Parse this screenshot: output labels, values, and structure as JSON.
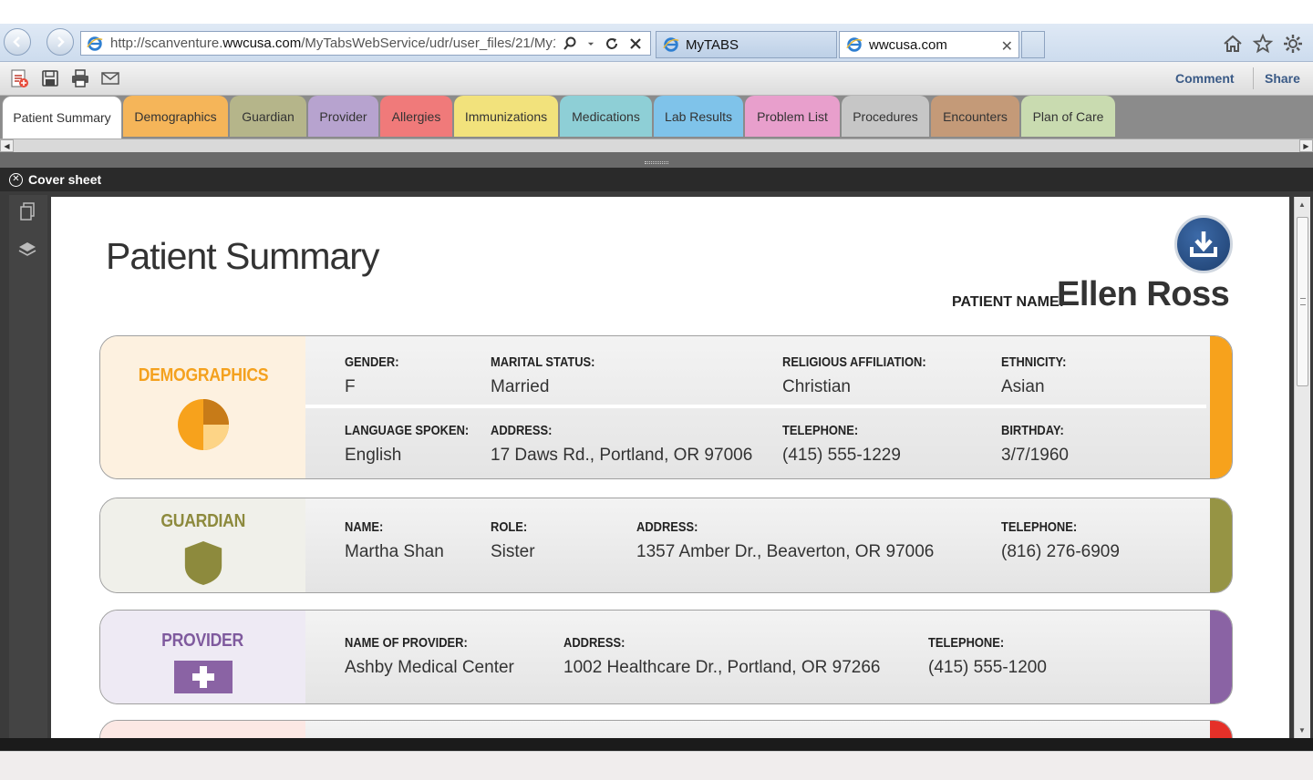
{
  "browser": {
    "url_prefix": "http://scanventure.",
    "url_domain": "wwcusa.com",
    "url_suffix": "/MyTabsWebService/udr/user_files/21/My1",
    "tabs": [
      {
        "title": "MyTABS"
      },
      {
        "title": "wwcusa.com",
        "close": "✕"
      }
    ]
  },
  "toolbar": {
    "comment_label": "Comment",
    "share_label": "Share"
  },
  "tabs": [
    {
      "label": "Patient Summary",
      "color": "#ffffff"
    },
    {
      "label": "Demographics",
      "color": "#f5b559"
    },
    {
      "label": "Guardian",
      "color": "#b5b58a"
    },
    {
      "label": "Provider",
      "color": "#b7a3cf"
    },
    {
      "label": "Allergies",
      "color": "#f07a7a"
    },
    {
      "label": "Immunizations",
      "color": "#f2e27c"
    },
    {
      "label": "Medications",
      "color": "#8ecfd6"
    },
    {
      "label": "Lab Results",
      "color": "#7fc3ea"
    },
    {
      "label": "Problem List",
      "color": "#e89fcc"
    },
    {
      "label": "Procedures",
      "color": "#c6c6c6"
    },
    {
      "label": "Encounters",
      "color": "#c49a78"
    },
    {
      "label": "Plan of Care",
      "color": "#c9dbb0"
    }
  ],
  "viewer": {
    "title": "Cover sheet",
    "close_glyph": "✕"
  },
  "doc": {
    "title": "Patient Summary",
    "patient_name_label": "PATIENT NAME:",
    "patient_name": "Ellen Ross"
  },
  "demographics": {
    "title": "DEMOGRAPHICS",
    "gender_label": "GENDER:",
    "gender": "F",
    "marital_label": "MARITAL STATUS:",
    "marital": "Married",
    "religion_label": "RELIGIOUS AFFILIATION:",
    "religion": "Christian",
    "ethnicity_label": "ETHNICITY:",
    "ethnicity": "Asian",
    "language_label": "LANGUAGE SPOKEN:",
    "language": "English",
    "address_label": "ADDRESS:",
    "address": "17 Daws Rd., Portland, OR 97006",
    "telephone_label": "TELEPHONE:",
    "telephone": "(415) 555-1229",
    "birthday_label": "BIRTHDAY:",
    "birthday": "3/7/1960"
  },
  "guardian": {
    "title": "GUARDIAN",
    "name_label": "NAME:",
    "name": "Martha Shan",
    "role_label": "ROLE:",
    "role": "Sister",
    "address_label": "ADDRESS:",
    "address": "1357 Amber Dr., Beaverton, OR 97006",
    "telephone_label": "TELEPHONE:",
    "telephone": "(816) 276-6909"
  },
  "provider": {
    "title": "PROVIDER",
    "name_label": "NAME OF PROVIDER:",
    "name": "Ashby Medical Center",
    "address_label": "ADDRESS:",
    "address": "1002 Healthcare Dr., Portland, OR 97266",
    "telephone_label": "TELEPHONE:",
    "telephone": "(415) 555-1200"
  }
}
